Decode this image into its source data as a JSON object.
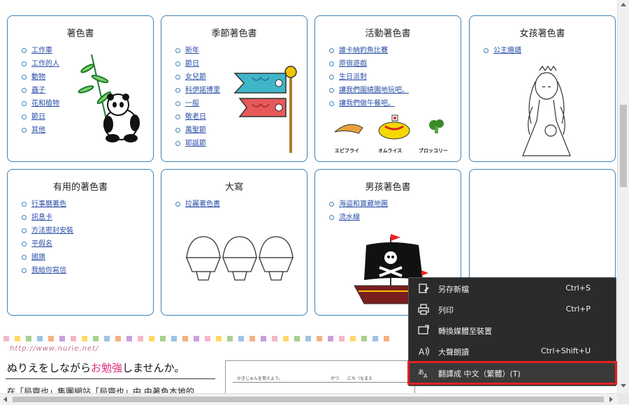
{
  "cards": [
    {
      "title": "著色書",
      "links": [
        "工作車",
        "工作的人",
        "動物",
        "蟲子",
        "花和植物",
        "節日",
        "其他"
      ]
    },
    {
      "title": "季節著色書",
      "links": [
        "新年",
        "節日",
        "女兒節",
        "科伊諾博里",
        "一般",
        "敬老日",
        "萬聖節",
        "耶誕節"
      ]
    },
    {
      "title": "活動著色書",
      "links": [
        "誰卡納釣魚比賽",
        "原宿遊戲",
        "生日派對",
        "讓我們圍繞園地玩吧。",
        "讓我們做午餐吧。"
      ],
      "food_labels": [
        "エビフライ",
        "オムライス",
        "ブロッコリー"
      ]
    },
    {
      "title": "女孩著色書",
      "links": [
        "公主繪譜"
      ]
    },
    {
      "title": "有用的著色書",
      "links": [
        "行事曆著色",
        "訊息卡",
        "方法密封安裝",
        "平假名",
        "國旗",
        "我給你寫信"
      ]
    },
    {
      "title": "大寫",
      "links": [
        "拉麗著色書"
      ]
    },
    {
      "title": "男孩著色書",
      "links": [
        "海盜和寶藏地圖",
        "流水線"
      ]
    },
    {
      "title": "",
      "links": []
    }
  ],
  "bottom": {
    "site_url": "http://www.nurie.net/",
    "heading_pre": "ぬりえをしながら",
    "heading_hl": "お勉強",
    "heading_post": "しませんか。",
    "body": "在「局齋也」集團網站「局齋也」中,由著色本地的",
    "worksheet_hdr": "かきじゅんを覚えよう。",
    "worksheet_hdr2": "がつ　　にち（なまえ"
  },
  "context_menu": {
    "items": [
      {
        "label": "另存新檔",
        "shortcut": "Ctrl+S",
        "icon": "save-as-icon"
      },
      {
        "label": "列印",
        "shortcut": "Ctrl+P",
        "icon": "print-icon"
      },
      {
        "label": "轉換媒體至裝置",
        "shortcut": "",
        "icon": "cast-icon"
      },
      {
        "label": "大聲朗讀",
        "shortcut": "Ctrl+Shift+U",
        "icon": "read-aloud-icon"
      },
      {
        "label": "翻譯成 中文（繁體）(T)",
        "shortcut": "",
        "icon": "translate-icon"
      }
    ],
    "highlight_color": "#e32222"
  },
  "colors": {
    "card_border": "#3d82b5",
    "link": "#2a4fa6",
    "menu_bg": "#2b2b2b"
  }
}
